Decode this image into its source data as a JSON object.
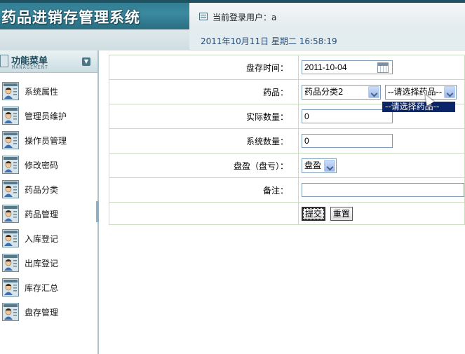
{
  "app": {
    "title": "药品进销存管理系统",
    "user_label": "当前登录用户：a",
    "datetime": "2011年10月11日  星期二  16:58:19"
  },
  "sidebar": {
    "title": "功能菜单",
    "subtitle": "MANAGEMENT",
    "items": [
      {
        "label": "系统属性"
      },
      {
        "label": "管理员维护"
      },
      {
        "label": "操作员管理"
      },
      {
        "label": "修改密码"
      },
      {
        "label": "药品分类"
      },
      {
        "label": "药品管理"
      },
      {
        "label": "入库登记"
      },
      {
        "label": "出库登记"
      },
      {
        "label": "库存汇总"
      },
      {
        "label": "盘存管理"
      }
    ]
  },
  "form": {
    "check_time": {
      "label": "盘存时间：",
      "value": "2011-10-04"
    },
    "drug": {
      "label": "药品：",
      "category_value": "药品分类2",
      "drug_value": "--请选择药品--",
      "dropdown_option": "--请选择药品--"
    },
    "actual_qty": {
      "label": "实际数量：",
      "value": "0"
    },
    "system_qty": {
      "label": "系统数量：",
      "value": "0"
    },
    "profit_loss": {
      "label": "盘盈（盘亏）：",
      "value": "盘盈"
    },
    "remark": {
      "label": "备注：",
      "value": ""
    },
    "submit_label": "提交",
    "reset_label": "重置"
  }
}
